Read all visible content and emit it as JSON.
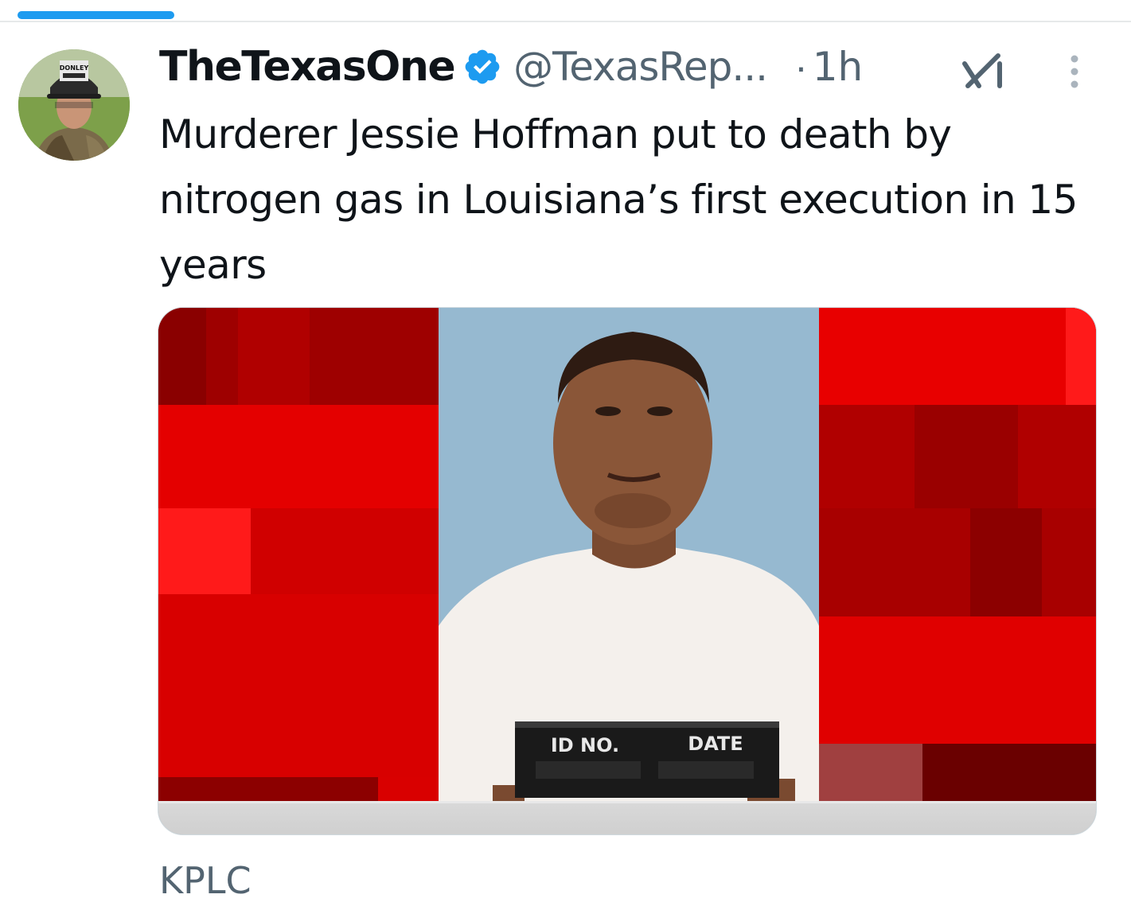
{
  "tweet": {
    "display_name": "TheTexasOne",
    "handle": "@TexasRep...",
    "separator": "·",
    "timestamp": "1h",
    "text": "Murderer Jessie Hoffman put to death by nitrogen gas in Louisiana’s first execution in 15 years",
    "verified": true
  },
  "avatar": {
    "hat_text": "DONLEY"
  },
  "card": {
    "placard_left_label": "ID NO.",
    "placard_right_label": "DATE"
  },
  "source": {
    "label": "KPLC"
  },
  "colors": {
    "accent": "#1d9bf0",
    "secondary_text": "#536471",
    "primary_text": "#0f1419",
    "background_red": "#e00000"
  },
  "icons": {
    "verified": "verified-badge-icon",
    "grok": "grok-icon",
    "more": "more-vertical-icon"
  }
}
